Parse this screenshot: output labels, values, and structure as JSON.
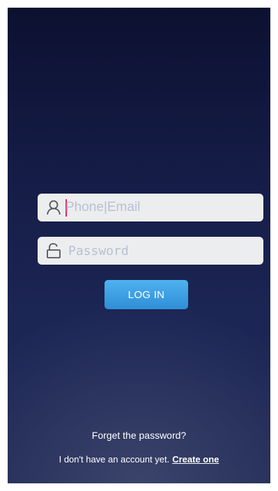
{
  "login": {
    "username_placeholder": "Phone|Email",
    "password_placeholder": "Password",
    "login_button": "LOG IN"
  },
  "footer": {
    "forget_password": "Forget the password?",
    "no_account_text": "I don't have an account yet.",
    "create_account_link": "Create one"
  },
  "icons": {
    "username": "user-icon",
    "password": "unlocked-lock-icon"
  },
  "colors": {
    "background_top": "#0c1131",
    "background_bottom": "#202a56",
    "field_background": "#ecedef",
    "placeholder": "#b9c0d2",
    "caret": "#e0245e",
    "button": "#3d9fe2",
    "text": "#ffffff"
  }
}
